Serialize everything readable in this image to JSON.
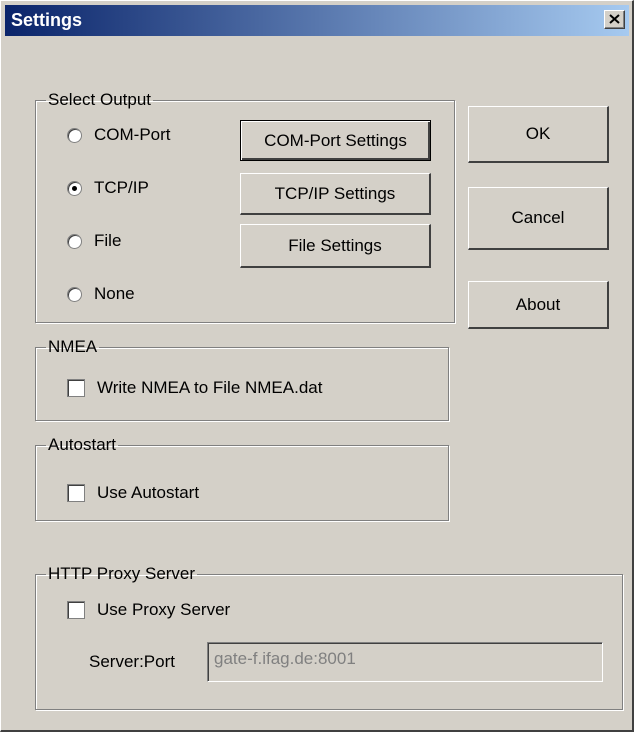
{
  "window": {
    "title": "Settings"
  },
  "select_output": {
    "legend": "Select Output",
    "options": [
      {
        "label": "COM-Port",
        "checked": false
      },
      {
        "label": "TCP/IP",
        "checked": true
      },
      {
        "label": "File",
        "checked": false
      },
      {
        "label": "None",
        "checked": false
      }
    ],
    "buttons": {
      "com_port_settings": "COM-Port Settings",
      "tcpip_settings": "TCP/IP Settings",
      "file_settings": "File Settings"
    }
  },
  "side_buttons": {
    "ok": "OK",
    "cancel": "Cancel",
    "about": "About"
  },
  "nmea": {
    "legend": "NMEA",
    "checkbox_label": "Write NMEA to File NMEA.dat",
    "checked": false
  },
  "autostart": {
    "legend": "Autostart",
    "checkbox_label": "Use Autostart",
    "checked": false
  },
  "proxy": {
    "legend": "HTTP Proxy Server",
    "checkbox_label": "Use Proxy Server",
    "checked": false,
    "server_port_label": "Server:Port",
    "server_port_value": "gate-f.ifag.de:8001"
  },
  "colors": {
    "title_start": "#0a246a",
    "title_end": "#a6caf0",
    "face": "#d4d0c8"
  }
}
